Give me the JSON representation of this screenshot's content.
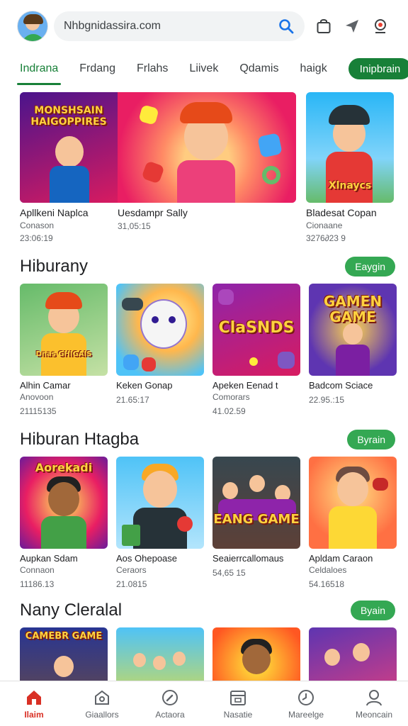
{
  "header": {
    "search_text": "Nhbgnidassira.com"
  },
  "tabs": [
    {
      "label": "Indrana",
      "active": true
    },
    {
      "label": "Frdang"
    },
    {
      "label": "Frlahs"
    },
    {
      "label": "Liivek"
    },
    {
      "label": "Qdamis"
    },
    {
      "label": "haigk"
    }
  ],
  "tab_pill": "Inipbrain",
  "featured": [
    {
      "title": "Apllkeni Naplca",
      "sub": "Conason",
      "meta": "23:06:19",
      "art_text": "MONSHSAIN\nHAIGOPPIRES"
    },
    {
      "title": "Uesdampr Sally",
      "sub": "",
      "meta": "31,05:15"
    },
    {
      "title": "Bladesat Copan",
      "sub": "Cionaane",
      "meta": "3276∂23 9",
      "art_text": "Xlnaycs"
    }
  ],
  "sections": [
    {
      "title": "Hiburany",
      "button": "Eaygin",
      "items": [
        {
          "title": "Alhin Camar",
          "sub": "Anovoon",
          "meta": "21115135",
          "art_text": "Dnas GHIGAIS"
        },
        {
          "title": "Keken Gonap",
          "sub": "",
          "meta": "21.65:17"
        },
        {
          "title": "Apeken Eenad t",
          "sub": "Comorars",
          "meta": "41.02.59",
          "art_text": "ClaSNDS"
        },
        {
          "title": "Badcom Sciace",
          "sub": "",
          "meta": "22.95.:15",
          "art_text": "GAMEN GAME"
        }
      ]
    },
    {
      "title": "Hiburan Htagba",
      "button": "Byrain",
      "items": [
        {
          "title": "Aupkan Sdam",
          "sub": "Connaon",
          "meta": "11186.13",
          "art_text": "Aorekadi"
        },
        {
          "title": "Aos Ohepoase",
          "sub": "Ceraors",
          "meta": "21.0815"
        },
        {
          "title": "Seaierrcallomaus",
          "sub": "",
          "meta": "54,65 15",
          "art_text": "EANG GAME"
        },
        {
          "title": "Apldam Caraon",
          "sub": "Celdaloes",
          "meta": "54.16518"
        }
      ]
    },
    {
      "title": "Nany Cleralal",
      "button": "Byain",
      "items": [
        {
          "title": "",
          "sub": "",
          "meta": "",
          "art_text": "CAMEBR GAME"
        },
        {
          "title": "",
          "sub": "",
          "meta": ""
        },
        {
          "title": "",
          "sub": "",
          "meta": ""
        },
        {
          "title": "",
          "sub": "",
          "meta": ""
        }
      ]
    }
  ],
  "bottom_nav": [
    {
      "label": "Ilaim",
      "icon": "home-icon",
      "active": true
    },
    {
      "label": "Giaallors",
      "icon": "games-icon"
    },
    {
      "label": "Actaora",
      "icon": "compass-icon"
    },
    {
      "label": "Nasatie",
      "icon": "calendar-icon"
    },
    {
      "label": "Mareelge",
      "icon": "clock-icon"
    },
    {
      "label": "Meoncain",
      "icon": "profile-icon"
    }
  ],
  "colors": {
    "accent": "#188038",
    "button": "#34a853",
    "nav_active": "#d93025"
  }
}
